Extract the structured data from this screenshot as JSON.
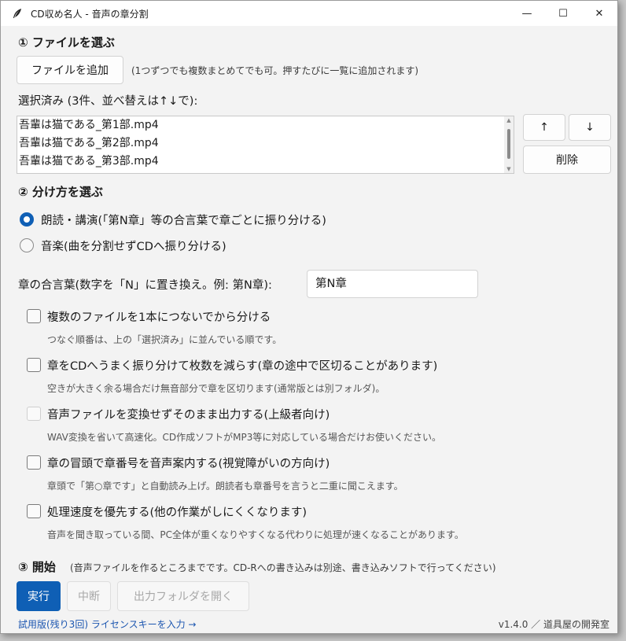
{
  "window": {
    "title": "CD収め名人 - 音声の章分割",
    "minimize_icon": "—",
    "maximize_icon": "☐",
    "close_icon": "✕"
  },
  "section1": {
    "heading": "① ファイルを選ぶ",
    "add_button": "ファイルを追加",
    "add_hint": "(1つずつでも複数まとめてでも可。押すたびに一覧に追加されます)",
    "selected_label": "選択済み (3件、並べ替えは↑↓で):",
    "files": [
      "吾輩は猫である_第1部.mp4",
      "吾輩は猫である_第2部.mp4",
      "吾輩は猫である_第3部.mp4"
    ],
    "up_button": "↑",
    "down_button": "↓",
    "delete_button": "削除"
  },
  "section2": {
    "heading": "② 分け方を選ぶ",
    "radio_reading": "朗読・講演(「第N章」等の合言葉で章ごとに振り分ける)",
    "radio_music": "音楽(曲を分割せずCDへ振り分ける)",
    "keyword_label": "章の合言葉(数字を「N」に置き換え。例: 第N章):",
    "keyword_value": "第N章",
    "options": [
      {
        "label": "複数のファイルを1本につないでから分ける",
        "desc": "つなぐ順番は、上の「選択済み」に並んでいる順です。"
      },
      {
        "label": "章をCDへうまく振り分けて枚数を減らす(章の途中で区切ることがあります)",
        "desc": "空きが大きく余る場合だけ無音部分で章を区切ります(通常版とは別フォルダ)。"
      },
      {
        "label": "音声ファイルを変換せずそのまま出力する(上級者向け)",
        "desc": "WAV変換を省いて高速化。CD作成ソフトがMP3等に対応している場合だけお使いください。"
      },
      {
        "label": "章の冒頭で章番号を音声案内する(視覚障がいの方向け)",
        "desc": "章頭で「第○章です」と自動読み上げ。朗読者も章番号を言うと二重に聞こえます。"
      },
      {
        "label": "処理速度を優先する(他の作業がしにくくなります)",
        "desc": "音声を聞き取っている間、PC全体が重くなりやすくなる代わりに処理が速くなることがあります。"
      }
    ]
  },
  "section3": {
    "heading": "③ 開始",
    "hint": "(音声ファイルを作るところまでです。CD-Rへの書き込みは別途、書き込みソフトで行ってください)",
    "run_button": "実行",
    "stop_button": "中断",
    "open_folder_button": "出力フォルダを開く"
  },
  "footer": {
    "trial_link": "試用版(残り3回) ライセンスキーを入力 →",
    "version": "v1.4.0 ／ 道具屋の開発室"
  },
  "colors": {
    "accent": "#0f5fb5",
    "link": "#1c56b0"
  }
}
